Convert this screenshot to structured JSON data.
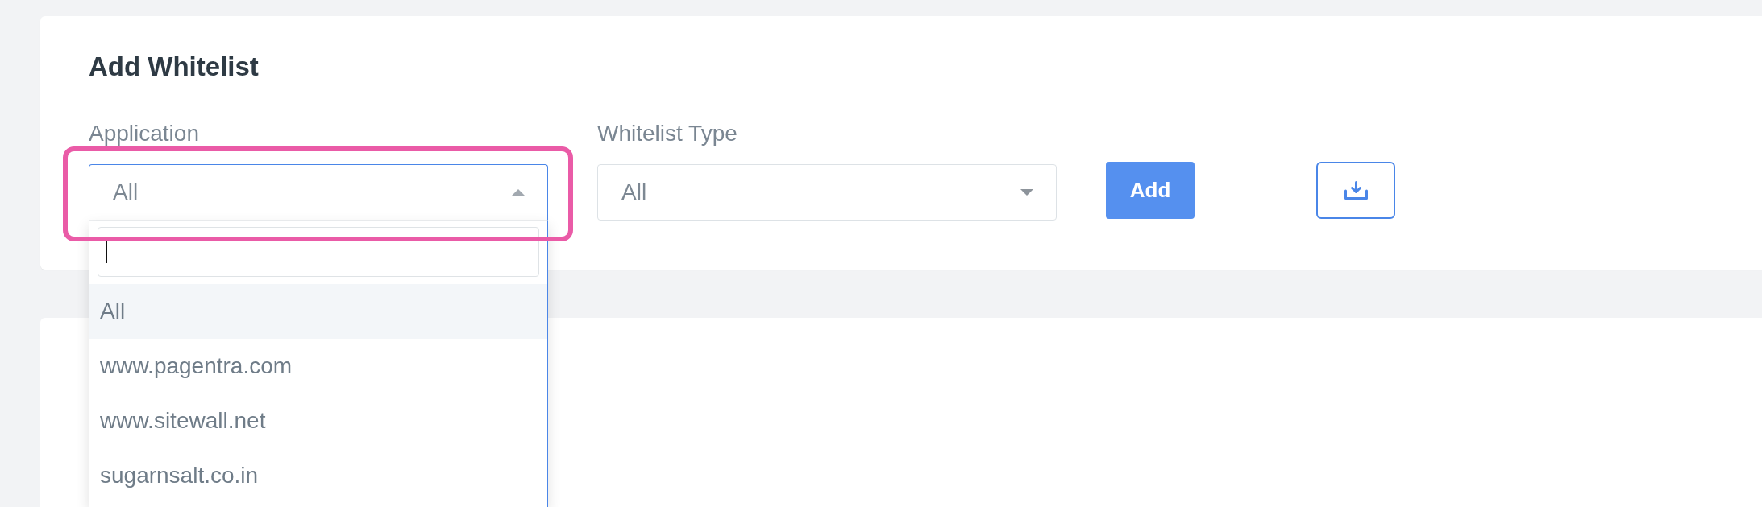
{
  "title": "Add Whitelist",
  "fields": [
    {
      "kind": "select",
      "label": "Application",
      "value": "All",
      "open": true,
      "highlighted": true,
      "search": {
        "focused": true
      },
      "options": [
        {
          "label": "All",
          "selected": true
        },
        {
          "label": "www.pagentra.com",
          "selected": false
        },
        {
          "label": "www.sitewall.net",
          "selected": false
        },
        {
          "label": "sugarnsalt.co.in",
          "selected": false
        }
      ]
    },
    {
      "kind": "select",
      "label": "Whitelist Type",
      "value": "All",
      "open": false,
      "highlighted": false
    }
  ],
  "buttons": [
    {
      "kind": "primary",
      "label": "Add"
    },
    {
      "kind": "download"
    }
  ]
}
